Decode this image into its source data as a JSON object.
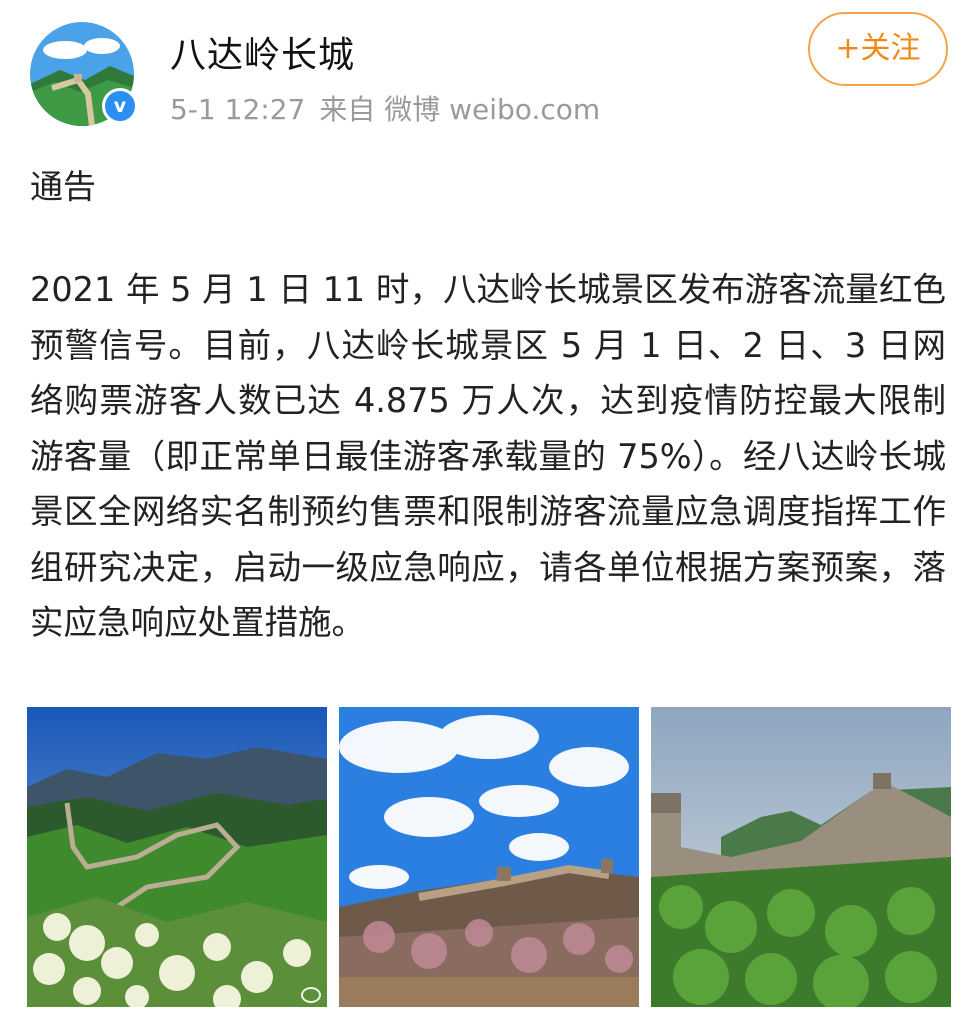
{
  "post": {
    "account_name": "八达岭长城",
    "time": "5-1 12:27",
    "source": "来自 微博 weibo.com",
    "follow_label": "+关注",
    "verified_mark": "v",
    "title": "通告",
    "body": "2021 年 5 月 1 日 11 时，八达岭长城景区发布游客流量红色预警信号。目前，八达岭长城景区 5 月 1 日、2 日、3 日网络购票游客人数已达 4.875 万人次，达到疫情防控最大限制游客量（即正常单日最佳游客承载量的 75%）。经八达岭长城景区全网络实名制预约售票和限制游客流量应急调度指挥工作组研究决定，启动一级应急响应，请各单位根据方案预案，落实应急响应处置措施。"
  },
  "colors": {
    "follow_accent": "#f08a17",
    "verified_badge": "#2a8ff0",
    "meta_text": "#9a9a9a"
  },
  "photos": [
    {
      "subject": "great-wall-mountain-flowers"
    },
    {
      "subject": "great-wall-blue-sky-clouds"
    },
    {
      "subject": "great-wall-green-forest"
    }
  ]
}
